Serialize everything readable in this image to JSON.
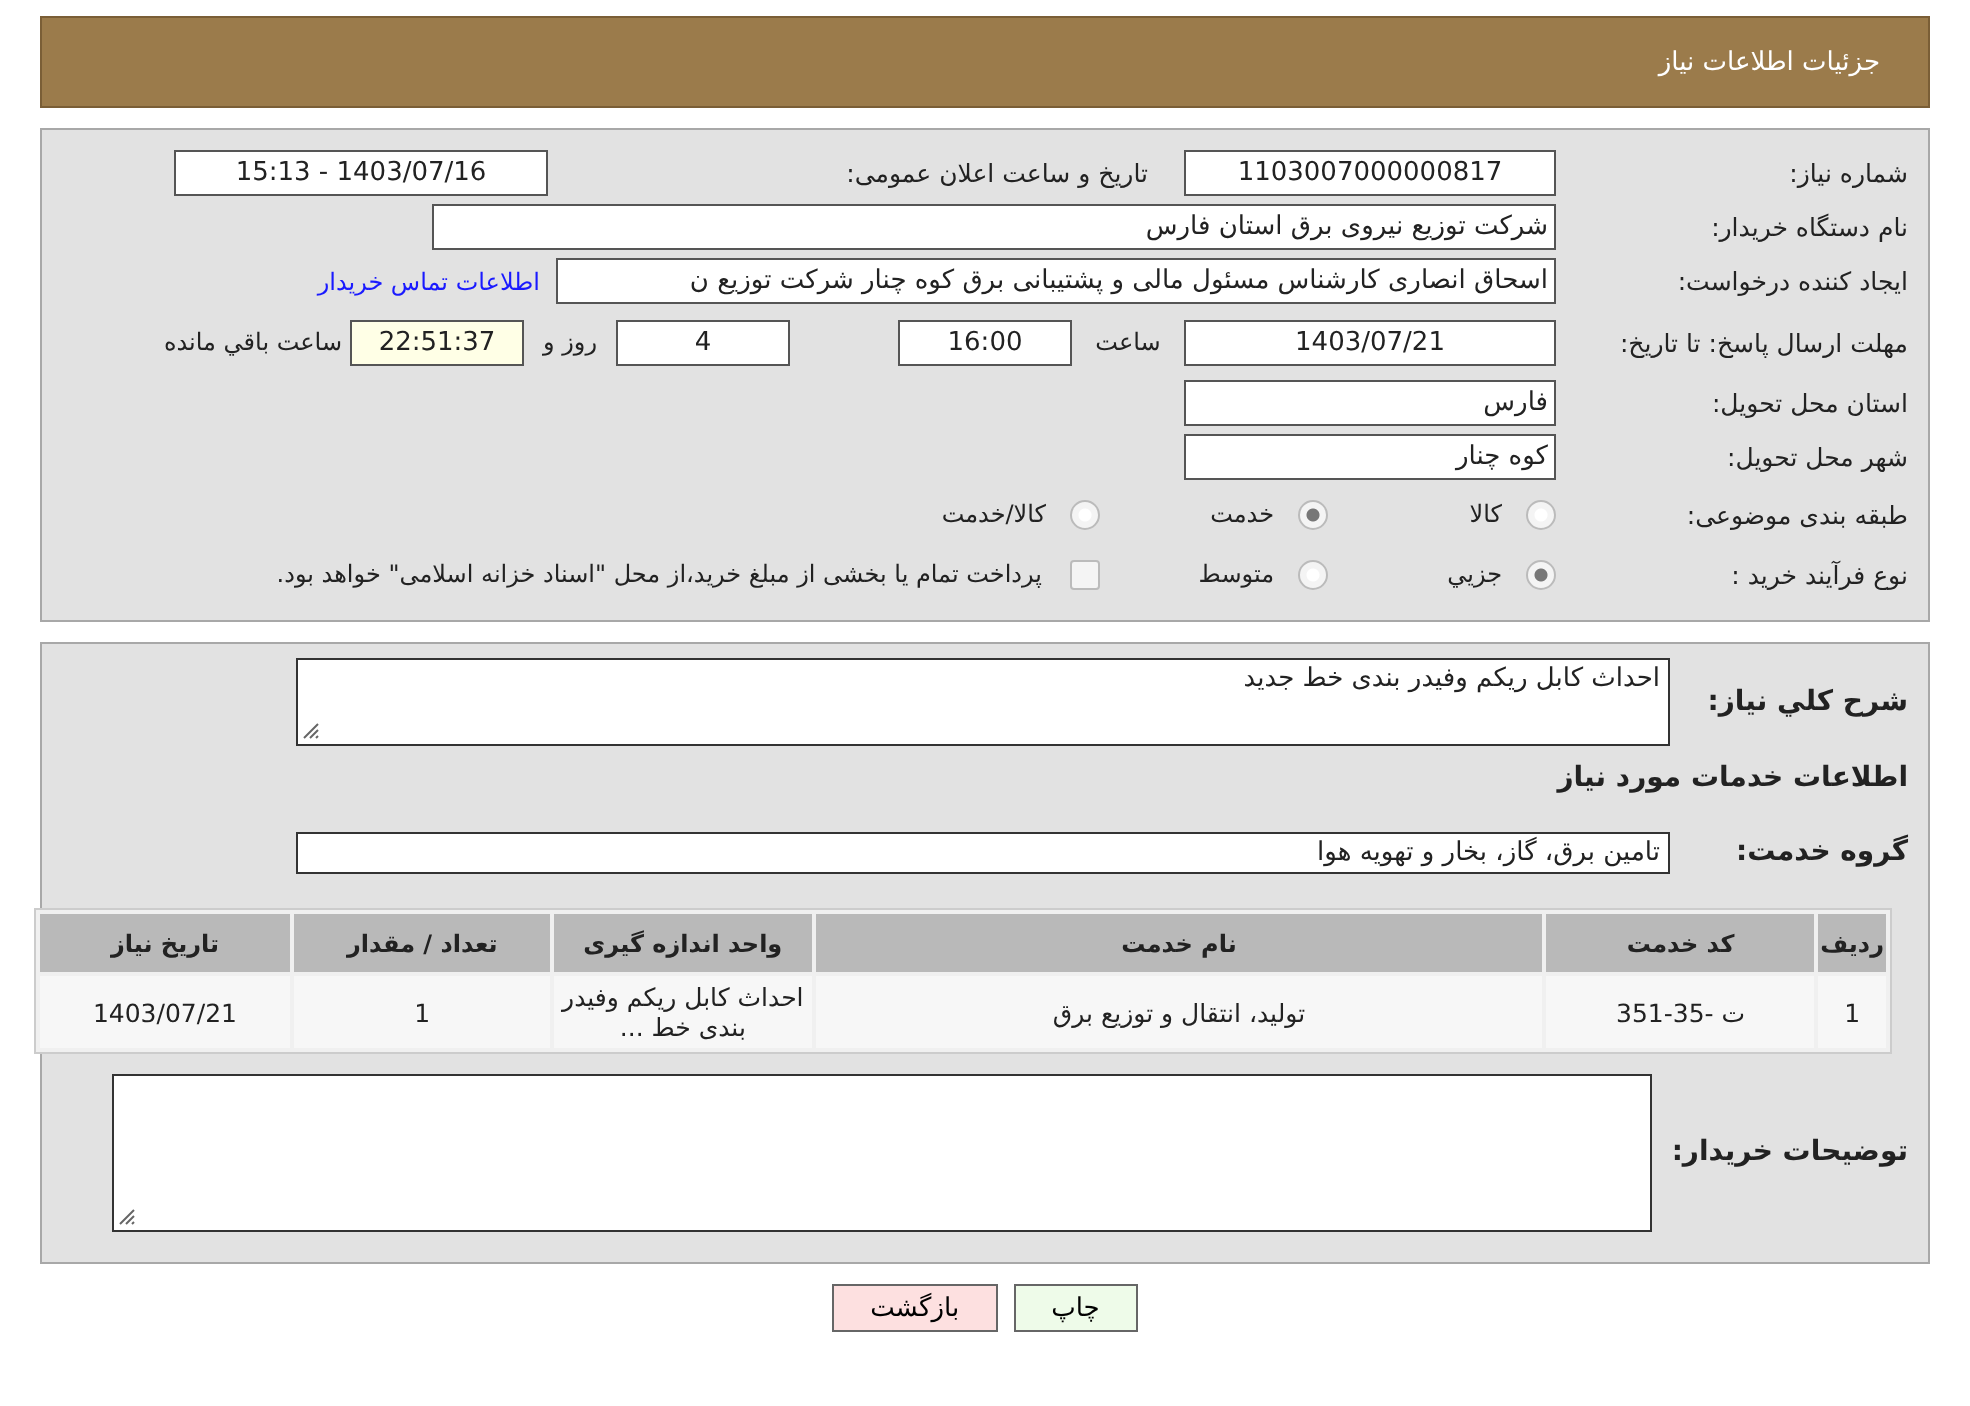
{
  "header": {
    "title": "جزئیات اطلاعات نیاز"
  },
  "need_number": {
    "label": "شماره نیاز:",
    "value": "1103007000000817"
  },
  "announce": {
    "label": "تاریخ و ساعت اعلان عمومی:",
    "value": "1403/07/16 - 15:13"
  },
  "buyer": {
    "label": "نام دستگاه خریدار:",
    "value": "شرکت توزیع نیروی برق استان فارس"
  },
  "creator": {
    "label": "ایجاد کننده درخواست:",
    "value": "اسحاق انصاری کارشناس مسئول مالی و پشتیبانی برق کوه چنار شرکت توزیع ن",
    "link": "اطلاعات تماس خریدار"
  },
  "deadline": {
    "label": "مهلت ارسال پاسخ: تا تاریخ:",
    "date": "1403/07/21",
    "time_label": "ساعت",
    "time": "16:00",
    "days": "4",
    "days_label": "روز و",
    "remaining": "22:51:37",
    "remaining_label": "ساعت باقي مانده"
  },
  "province": {
    "label": "استان محل تحویل:",
    "value": "فارس"
  },
  "city": {
    "label": "شهر محل تحویل:",
    "value": "کوه چنار"
  },
  "category": {
    "label": "طبقه بندی موضوعی:",
    "options": [
      {
        "label": "کالا",
        "selected": false
      },
      {
        "label": "خدمت",
        "selected": true
      },
      {
        "label": "کالا/خدمت",
        "selected": false
      }
    ]
  },
  "process": {
    "label": "نوع فرآیند خرید :",
    "options": [
      {
        "label": "جزيي",
        "selected": true
      },
      {
        "label": "متوسط",
        "selected": false
      }
    ],
    "treasury": {
      "label": "پرداخت تمام یا بخشی از مبلغ خرید،از محل \"اسناد خزانه اسلامی\" خواهد بود.",
      "checked": false
    }
  },
  "description": {
    "label": "شرح کلي نياز:",
    "value": "احداث کابل ریکم وفیدر بندی خط جدید"
  },
  "services_heading": "اطلاعات خدمات مورد نياز",
  "service_group": {
    "label": "گروه خدمت:",
    "value": "تامين برق، گاز، بخار و تهويه هوا"
  },
  "table": {
    "columns": [
      "رديف",
      "کد خدمت",
      "نام خدمت",
      "واحد اندازه گيری",
      "تعداد / مقدار",
      "تاريخ نياز"
    ],
    "rows": [
      [
        "1",
        "ت -35-351",
        "توليد، انتقال و توزيع برق",
        "احداث کابل ریکم وفیدر بندی خط ...",
        "1",
        "1403/07/21"
      ]
    ]
  },
  "buyer_notes": {
    "label": "توضيحات خريدار:"
  },
  "buttons": {
    "print": "چاپ",
    "back": "بازگشت"
  }
}
